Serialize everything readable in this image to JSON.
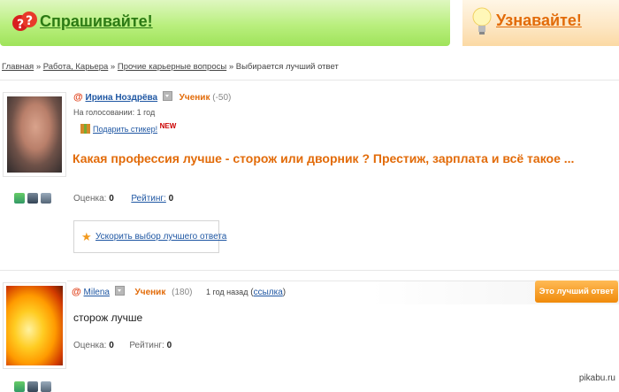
{
  "header": {
    "ask_title": "Спрашивайте!",
    "know_title": "Узнавайте!"
  },
  "breadcrumb": {
    "items": [
      "Главная",
      "Работа, Карьера",
      "Прочие карьерные вопросы"
    ],
    "current": "Выбирается лучший ответ",
    "separator": "»"
  },
  "question": {
    "author": "Ирина Ноздрёва",
    "rank": "Ученик",
    "points": "(-50)",
    "voting_status": "На голосовании: 1 год",
    "gift_label": "Подарить стикер!",
    "new_badge": "NEW",
    "text": "Какая профессия лучше - сторож или дворник ? Престиж, зарплата и всё такое ...",
    "score_label": "Оценка:",
    "score_value": "0",
    "rating_label": "Рейтинг:",
    "rating_value": "0",
    "speed_up_label": "Ускорить выбор лучшего ответа"
  },
  "answer": {
    "author": "Milena",
    "rank": "Ученик",
    "points": "(180)",
    "time": "1 год назад",
    "link_label": "ссылка",
    "best_button": "Это лучший ответ",
    "text": "сторож лучше",
    "score_label": "Оценка:",
    "score_value": "0",
    "rating_label": "Рейтинг:",
    "rating_value": "0"
  },
  "watermark": "pikabu.ru",
  "colors": {
    "ask_green": "#2c7a14",
    "know_orange": "#e26b09",
    "question_orange": "#e26b09",
    "link_blue": "#1f57a3",
    "best_button": "#f08a0a"
  }
}
